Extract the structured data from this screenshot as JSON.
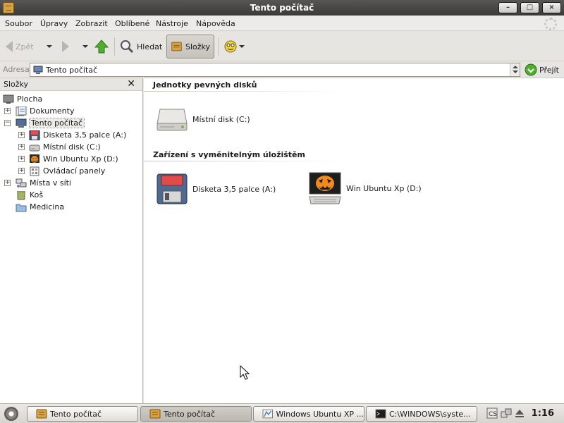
{
  "window": {
    "title": "Tento počítač",
    "buttons": {
      "minimize": "–",
      "maximize": "□",
      "close": "×"
    }
  },
  "menu": [
    "Soubor",
    "Úpravy",
    "Zobrazit",
    "Oblíbené",
    "Nástroje",
    "Nápověda"
  ],
  "toolbar": {
    "back_label": "Zpět",
    "search_label": "Hledat",
    "folders_label": "Složky"
  },
  "address": {
    "label": "Adresa",
    "value": "Tento počítač",
    "go_label": "Přejít"
  },
  "folder_pane": {
    "title": "Složky",
    "close": "✕",
    "tree": [
      {
        "label": "Plocha",
        "icon": "desktop-icon"
      },
      {
        "label": "Dokumenty",
        "icon": "documents-icon",
        "expander": "+"
      },
      {
        "label": "Tento počítač",
        "icon": "computer-icon",
        "expander": "−",
        "selected": true
      },
      {
        "label": "Disketa 3,5 palce (A:)",
        "icon": "floppy-icon",
        "expander": "+"
      },
      {
        "label": "Místní disk (C:)",
        "icon": "hard-disk-icon",
        "expander": "+"
      },
      {
        "label": "Win Ubuntu Xp (D:)",
        "icon": "pumpkin-drive-icon",
        "expander": "+"
      },
      {
        "label": "Ovládací panely",
        "icon": "control-panel-icon",
        "expander": "+"
      },
      {
        "label": "Místa v síti",
        "icon": "network-icon",
        "expander": "+"
      },
      {
        "label": "Koš",
        "icon": "trash-icon"
      },
      {
        "label": "Medicina",
        "icon": "folder-icon"
      }
    ]
  },
  "content": {
    "sections": [
      {
        "title": "Jednotky pevných disků",
        "items": [
          {
            "label": "Místní disk (C:)",
            "icon": "hard-disk-icon"
          }
        ]
      },
      {
        "title": "Zařízení s vyměnitelným úložištěm",
        "items": [
          {
            "label": "Disketa 3,5 palce (A:)",
            "icon": "floppy-icon"
          },
          {
            "label": "Win Ubuntu Xp (D:)",
            "icon": "pumpkin-computer-icon"
          }
        ]
      }
    ]
  },
  "taskbar": {
    "tasks": [
      {
        "label": "Tento počítač",
        "icon": "folder-window-icon"
      },
      {
        "label": "Tento počítač",
        "icon": "folder-window-icon",
        "active": true
      },
      {
        "label": "Windows Ubuntu XP ...",
        "icon": "browser-icon"
      },
      {
        "label": "C:\\WINDOWS\\syste...",
        "icon": "console-icon"
      }
    ],
    "tray": [
      "language-icon",
      "network-status-icon",
      "eject-icon"
    ],
    "clock": "1:16"
  }
}
